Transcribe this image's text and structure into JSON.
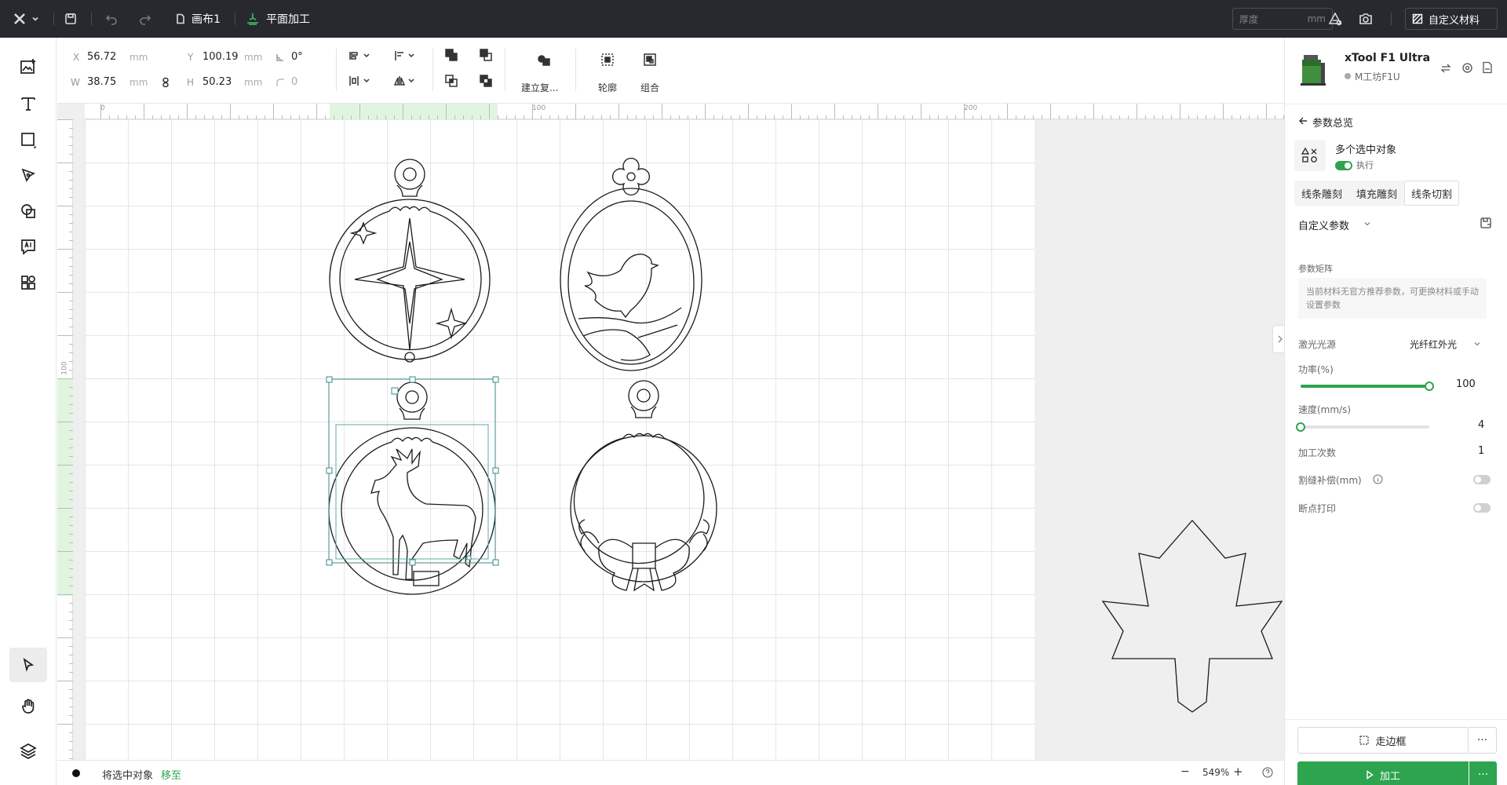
{
  "topbar": {
    "canvas_name": "画布1",
    "mode": "平面加工",
    "thickness_placeholder": "厚度",
    "thickness_unit": "mm",
    "material_button": "自定义材料"
  },
  "properties": {
    "x_label": "X",
    "x_value": "56.72",
    "x_unit": "mm",
    "y_label": "Y",
    "y_value": "100.19",
    "y_unit": "mm",
    "w_label": "W",
    "w_value": "38.75",
    "w_unit": "mm",
    "h_label": "H",
    "h_value": "50.23",
    "h_unit": "mm",
    "rotation_value": "0°",
    "corner_value": "0",
    "build_label": "建立复...",
    "outline_label": "轮廓",
    "group_label": "组合"
  },
  "rulers": {
    "top_ticks": [
      "0",
      "100",
      "200"
    ],
    "left_ticks": [
      "100"
    ]
  },
  "status": {
    "text": "将选中对象",
    "link": "移至",
    "zoom": "549%"
  },
  "device": {
    "name": "xTool F1 Ultra",
    "status": "M工坊F1U"
  },
  "panel": {
    "back_label": "参数总览",
    "object_title": "多个选中对象",
    "execute_label": "执行",
    "tabs": [
      "线条雕刻",
      "填充雕刻",
      "线条切割"
    ],
    "active_tab": 2,
    "custom_params": "自定义参数",
    "matrix_label": "参数矩阵",
    "matrix_hint": "当前材料无官方推荐参数，可更换材料或手动设置参数",
    "laser_label": "激光光源",
    "laser_value": "光纤红外光",
    "power_label": "功率(%)",
    "power_value": "100",
    "power_fraction": 1.0,
    "speed_label": "速度(mm/s)",
    "speed_value": "4",
    "speed_fraction": 0.0,
    "passes_label": "加工次数",
    "passes_value": "1",
    "kerf_label": "割缝补偿(mm)",
    "kerf_on": false,
    "breakpoint_label": "断点打印",
    "breakpoint_on": false,
    "frame_button": "走边框",
    "process_button": "加工"
  },
  "colors": {
    "accent": "#2ea44f",
    "topbar": "#27292e",
    "selection": "#3a8a86"
  }
}
